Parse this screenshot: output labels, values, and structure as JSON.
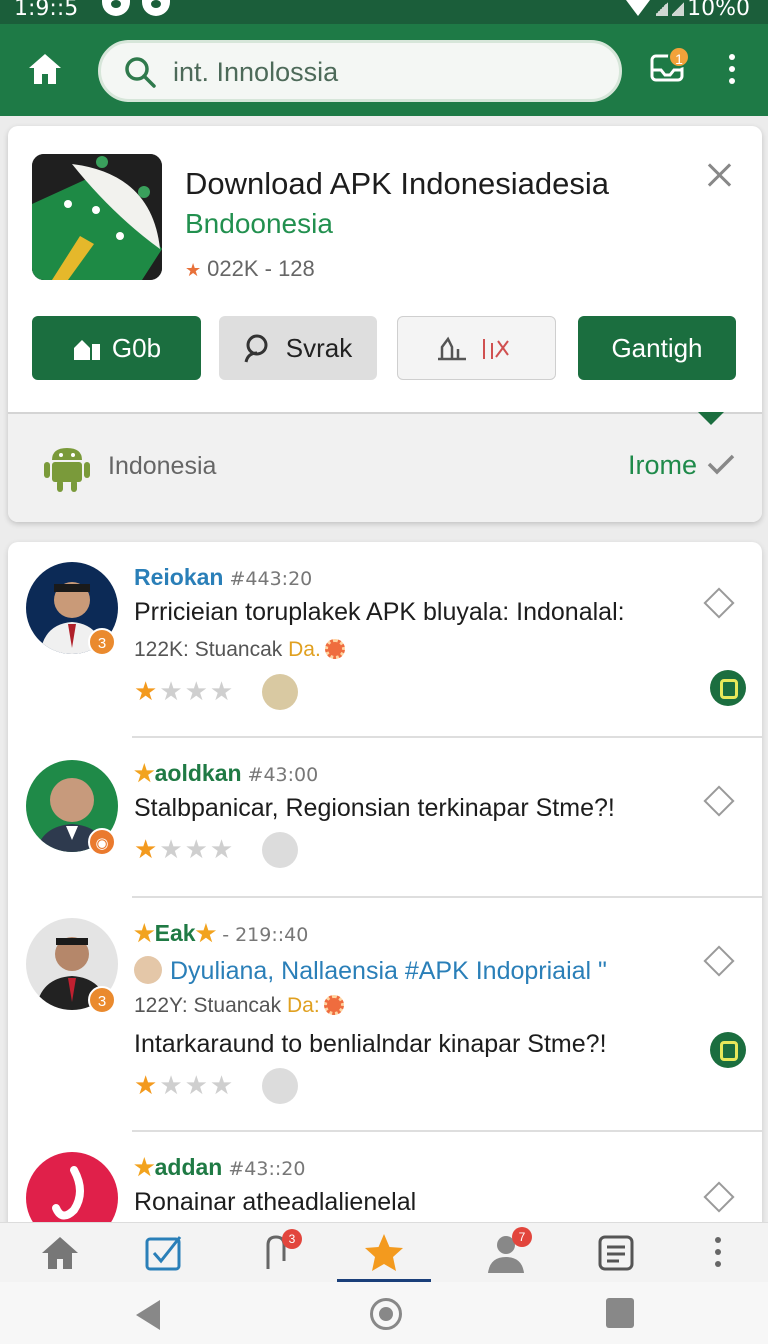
{
  "status_bar": {
    "time": "1:9::5",
    "battery_text": "10%0"
  },
  "app_bar": {
    "search_query": "int. Innolossia",
    "notification_count": "1"
  },
  "app_card": {
    "title": "Download APK Indonesiadesia",
    "subtitle": "Bndoonesia",
    "meta": "022K - 128",
    "buttons": {
      "get": "G0b",
      "search": "Svrak",
      "tools": "ꟷ|ʞ",
      "main": "Gantigh"
    },
    "region_label": "Indonesia",
    "region_value": "Irome"
  },
  "posts": [
    {
      "author": "Reiokan",
      "time": "#443:20",
      "text": "Prricieian toruplakek APK bluyala: Indonalal:",
      "meta_prefix": "122K: Stuancak",
      "meta_highlight": "Da.",
      "rating": 1,
      "badge": "3"
    },
    {
      "author": "aoldkan",
      "time": "#43:00",
      "text": "Stalbpanicar, Regionsian terkinapar Stme?!",
      "rating": 1,
      "badge": ""
    },
    {
      "author": "Eak",
      "time": "- 219::40",
      "mention": "Dyuliana, Nallaensia #APK Indopriaial \"",
      "meta_prefix": "122Y: Stuancak",
      "meta_highlight": "Da:",
      "text": "Intarkaraund to benlialndar kinapar Stme?!",
      "rating": 1,
      "badge": "3"
    },
    {
      "author": "addan",
      "time": "#43::20",
      "text": "Ronainar atheadlalienelal"
    }
  ],
  "tab_bar": {
    "badges": {
      "tab3": "3",
      "tab5": "7"
    }
  },
  "colors": {
    "brand_green": "#1e7a46",
    "button_green": "#1b6e3f",
    "accent_orange": "#f39a1e",
    "link_blue": "#2a7fb8"
  }
}
